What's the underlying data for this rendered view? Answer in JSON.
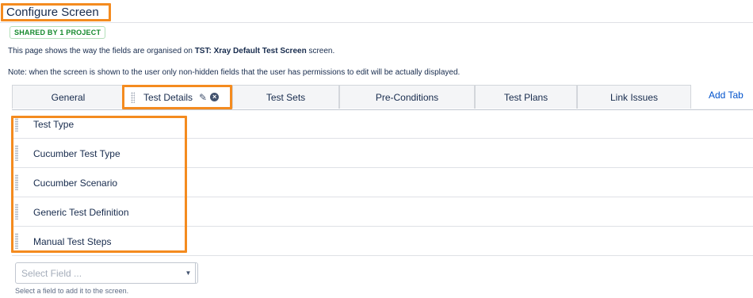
{
  "page": {
    "title": "Configure Screen",
    "shared_badge": "SHARED BY 1 PROJECT",
    "description_prefix": "This page shows the way the fields are organised on ",
    "description_screen": "TST: Xray Default Test Screen",
    "description_suffix": " screen.",
    "note": "Note: when the screen is shown to the user only non-hidden fields that the user has permissions to edit will be actually displayed."
  },
  "tabs": [
    {
      "label": "General"
    },
    {
      "label": "Test Details",
      "active": true
    },
    {
      "label": "Test Sets"
    },
    {
      "label": "Pre-Conditions"
    },
    {
      "label": "Test Plans"
    },
    {
      "label": "Link Issues"
    }
  ],
  "add_tab_label": "Add Tab",
  "fields": [
    {
      "label": "Test Type"
    },
    {
      "label": "Cucumber Test Type"
    },
    {
      "label": "Cucumber Scenario"
    },
    {
      "label": "Generic Test Definition"
    },
    {
      "label": "Manual Test Steps"
    }
  ],
  "select_field": {
    "placeholder": "Select Field ...",
    "hint": "Select a field to add it to the screen."
  },
  "icons": {
    "edit": "pencil-icon",
    "remove": "close-circle-icon",
    "dropdown": "chevron-down-icon"
  },
  "colors": {
    "highlight": "#f48b1f",
    "link": "#0052cc",
    "badge": "#14892c"
  }
}
